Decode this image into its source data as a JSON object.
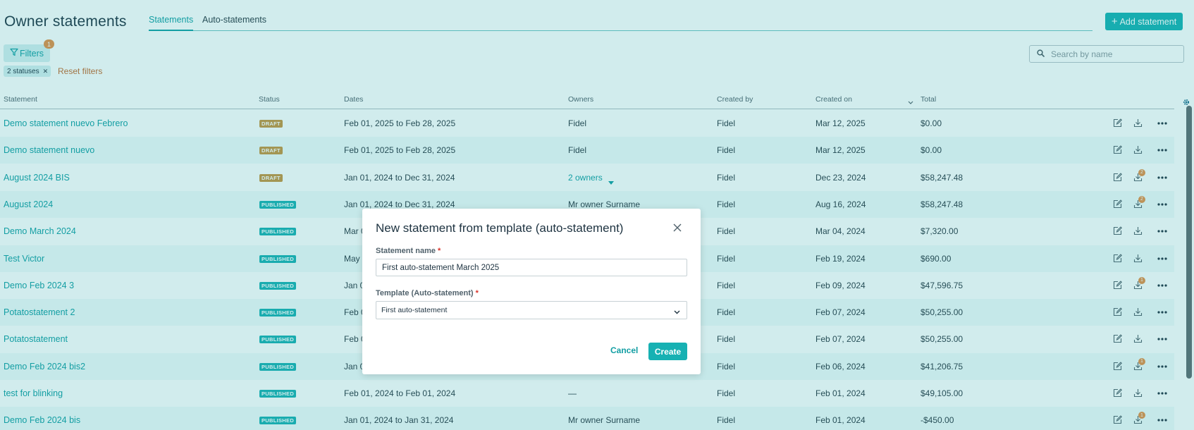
{
  "header": {
    "title": "Owner statements",
    "tabs": [
      {
        "label": "Statements",
        "active": true
      },
      {
        "label": "Auto-statements",
        "active": false
      }
    ],
    "add_button_label": "Add statement"
  },
  "filters": {
    "button_label": "Filters",
    "count_badge": "1",
    "chips": [
      {
        "label": "2 statuses"
      }
    ],
    "reset_label": "Reset filters"
  },
  "search": {
    "placeholder": "Search by name"
  },
  "table": {
    "columns": {
      "statement": "Statement",
      "status": "Status",
      "dates": "Dates",
      "owners": "Owners",
      "created_by": "Created by",
      "created_on": "Created on",
      "total": "Total"
    },
    "rows": [
      {
        "name": "Demo statement nuevo Febrero",
        "status": "DRAFT",
        "dates": "Feb 01, 2025 to Feb 28, 2025",
        "owners": "Fidel",
        "created_by": "Fidel",
        "created_on": "Mar 12, 2025",
        "total": "$0.00",
        "download_count": ""
      },
      {
        "name": "Demo statement nuevo",
        "status": "DRAFT",
        "dates": "Feb 01, 2025 to Feb 28, 2025",
        "owners": "Fidel",
        "created_by": "Fidel",
        "created_on": "Mar 12, 2025",
        "total": "$0.00",
        "download_count": ""
      },
      {
        "name": "August 2024 BIS",
        "status": "DRAFT",
        "dates": "Jan 01, 2024 to Dec 31, 2024",
        "owners": "2 owners",
        "created_by": "Fidel",
        "created_on": "Dec 23, 2024",
        "total": "$58,247.48",
        "download_count": "2"
      },
      {
        "name": "August 2024",
        "status": "PUBLISHED",
        "dates": "Jan 01, 2024 to Dec 31, 2024",
        "owners": "Mr owner Surname",
        "created_by": "Fidel",
        "created_on": "Aug 16, 2024",
        "total": "$58,247.48",
        "download_count": "2"
      },
      {
        "name": "Demo March 2024",
        "status": "PUBLISHED",
        "dates": "Mar 0",
        "owners": "",
        "created_by": "Fidel",
        "created_on": "Mar 04, 2024",
        "total": "$7,320.00",
        "download_count": ""
      },
      {
        "name": "Test Victor",
        "status": "PUBLISHED",
        "dates": "May 0",
        "owners": "",
        "created_by": "Fidel",
        "created_on": "Feb 19, 2024",
        "total": "$690.00",
        "download_count": ""
      },
      {
        "name": "Demo Feb 2024 3",
        "status": "PUBLISHED",
        "dates": "Jan 0",
        "owners": "",
        "created_by": "Fidel",
        "created_on": "Feb 09, 2024",
        "total": "$47,596.75",
        "download_count": "1"
      },
      {
        "name": "Potatostatement 2",
        "status": "PUBLISHED",
        "dates": "Feb 0",
        "owners": "",
        "created_by": "Fidel",
        "created_on": "Feb 07, 2024",
        "total": "$50,255.00",
        "download_count": ""
      },
      {
        "name": "Potatostatement",
        "status": "PUBLISHED",
        "dates": "Feb 0",
        "owners": "",
        "created_by": "Fidel",
        "created_on": "Feb 07, 2024",
        "total": "$50,255.00",
        "download_count": ""
      },
      {
        "name": "Demo Feb 2024 bis2",
        "status": "PUBLISHED",
        "dates": "Jan 0",
        "owners": "",
        "created_by": "Fidel",
        "created_on": "Feb 06, 2024",
        "total": "$41,206.75",
        "download_count": "1"
      },
      {
        "name": "test for blinking",
        "status": "PUBLISHED",
        "dates": "Feb 01, 2024 to Feb 01, 2024",
        "owners": "—",
        "created_by": "Fidel",
        "created_on": "Feb 01, 2024",
        "total": "$49,105.00",
        "download_count": ""
      },
      {
        "name": "Demo Feb 2024 bis",
        "status": "PUBLISHED",
        "dates": "Jan 01, 2024 to Jan 31, 2024",
        "owners": "Mr owner Surname",
        "created_by": "Fidel",
        "created_on": "Feb 01, 2024",
        "total": "-$450.00",
        "download_count": "1"
      }
    ]
  },
  "modal": {
    "title": "New statement from template (auto-statement)",
    "name_label": "Statement name",
    "name_value": "First auto-statement March 2025",
    "template_label": "Template (Auto-statement)",
    "template_value": "First auto-statement",
    "required_mark": "*",
    "cancel_label": "Cancel",
    "create_label": "Create"
  },
  "icons": {
    "filter": "filter-icon",
    "search": "search-icon",
    "edit": "edit-icon",
    "download": "download-icon",
    "more": "more-icon",
    "settings": "gear-icon",
    "close": "close-icon",
    "chevron": "chevron-down-icon"
  },
  "colors": {
    "accent": "#17b1b3",
    "draft": "#c6943f",
    "published": "#19b0b2",
    "notification": "#e58f45",
    "reset": "#c46a2e"
  }
}
